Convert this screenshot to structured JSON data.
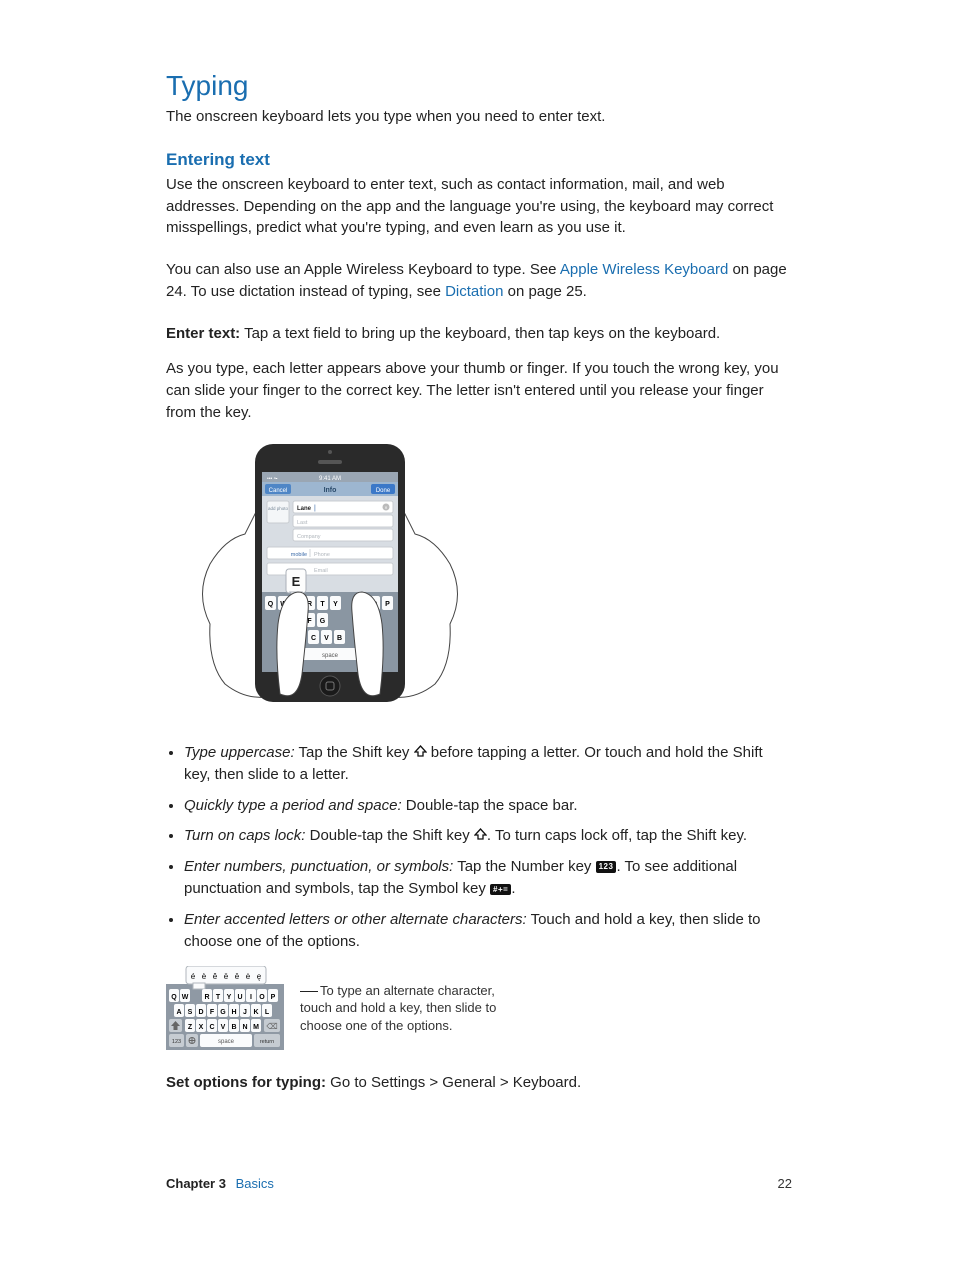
{
  "title": "Typing",
  "intro": "The onscreen keyboard lets you type when you need to enter text.",
  "subhead": "Entering text",
  "p1": "Use the onscreen keyboard to enter text, such as contact information, mail, and web addresses. Depending on the app and the language you're using, the keyboard may correct misspellings, predict what you're typing, and even learn as you use it.",
  "p2a": "You can also use an Apple Wireless Keyboard to type. See ",
  "p2_link1": "Apple Wireless Keyboard",
  "p2b": " on page 24. To use dictation instead of typing, see ",
  "p2_link2": "Dictation",
  "p2c": " on page 25.",
  "enter_text_label": "Enter text:",
  "enter_text_body": "  Tap a text field to bring up the keyboard, then tap keys on the keyboard.",
  "p3": "As you type, each letter appears above your thumb or finger. If you touch the wrong key, you can slide your finger to the correct key. The letter isn't entered until you release your finger from the key.",
  "bullets": {
    "b1_label": "Type uppercase:",
    "b1_a": "  Tap the Shift key ",
    "b1_b": " before tapping a letter. Or touch and hold the Shift key, then slide to a letter.",
    "b2_label": "Quickly type a period and space:",
    "b2_a": "  Double-tap the space bar.",
    "b3_label": "Turn on caps lock:",
    "b3_a": "  Double-tap the Shift key ",
    "b3_b": ". To turn caps lock off, tap the Shift key.",
    "b4_label": "Enter numbers, punctuation, or symbols:",
    "b4_a": "  Tap the Number key ",
    "b4_b": ". To see additional punctuation and symbols, tap the Symbol key ",
    "b4_c": ".",
    "b5_label": "Enter accented letters or other alternate characters:",
    "b5_a": "  Touch and hold a key, then slide to choose one of the options."
  },
  "icon_123": "123",
  "icon_sym": "#+=",
  "kbd_caption": "To type an alternate character, touch and hold a key, then slide to choose one of the options.",
  "set_options_label": "Set options for typing:",
  "set_options_body": "  Go to Settings > General > Keyboard.",
  "footer": {
    "chapter": "Chapter  3",
    "name": "Basics",
    "page": "22"
  },
  "phone": {
    "time": "9:41 AM",
    "header": "Info",
    "cancel": "Cancel",
    "done": "Done",
    "add_photo": "add photo",
    "first": "Lane",
    "last": "Last",
    "company": "Company",
    "mobile": "mobile",
    "phone_ph": "Phone",
    "email_label": "e",
    "email_ph": "Email",
    "popup_letter": "E",
    "space": "space",
    "row1": [
      "Q",
      "W",
      "",
      "R",
      "T",
      "Y",
      "",
      "",
      "O",
      "P"
    ],
    "row2": [
      "F",
      "G"
    ],
    "row3": [
      "C",
      "V",
      "B"
    ]
  },
  "kbd_small": {
    "accents": [
      "é",
      "è",
      "ê",
      "ë",
      "ē",
      "ė",
      "ę"
    ],
    "row1": [
      "Q",
      "W",
      "",
      "E",
      "R",
      "T",
      "Y",
      "U",
      "I",
      "O",
      "P"
    ],
    "row2": [
      "A",
      "S",
      "D",
      "F",
      "G",
      "H",
      "J",
      "K",
      "L"
    ],
    "row3": [
      "Z",
      "X",
      "C",
      "V",
      "B",
      "N",
      "M"
    ],
    "num": "123",
    "space": "space",
    "return": "return"
  }
}
